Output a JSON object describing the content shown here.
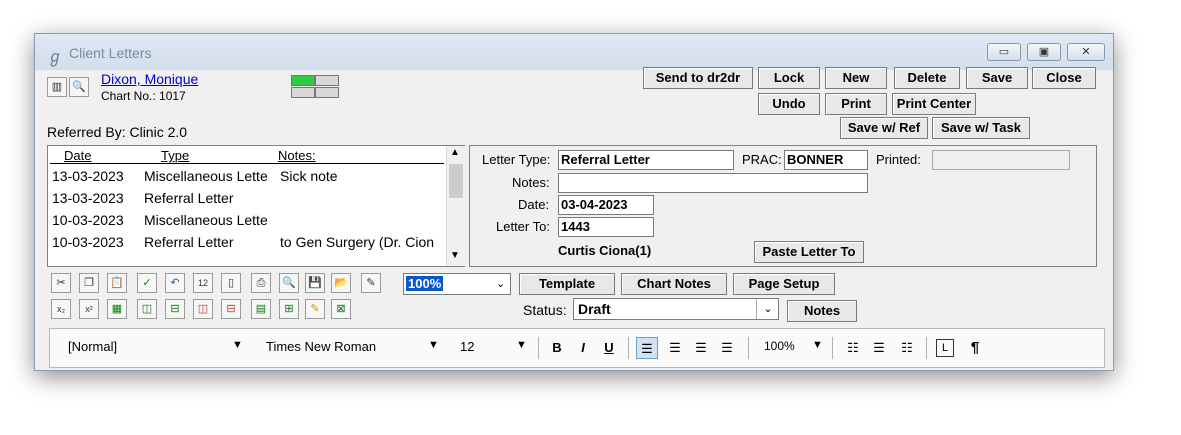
{
  "window": {
    "title": "Client Letters",
    "controls": [
      "minimize-icon",
      "restore-icon",
      "close-icon"
    ]
  },
  "patient": {
    "name": "Dixon, Monique",
    "chart_no": "Chart No.: 1017",
    "referred_by": "Referred By: Clinic 2.0"
  },
  "actions": {
    "send": "Send to dr2dr",
    "lock": "Lock",
    "new": "New",
    "delete": "Delete",
    "save": "Save",
    "close": "Close",
    "undo": "Undo",
    "print": "Print",
    "print_center": "Print Center",
    "save_ref": "Save w/ Ref",
    "save_task": "Save w/ Task"
  },
  "letters_list": {
    "headers": [
      "Date",
      "Type",
      "Notes:"
    ],
    "rows": [
      {
        "date": "13-03-2023",
        "type": "Miscellaneous Lette",
        "notes": "Sick note"
      },
      {
        "date": "13-03-2023",
        "type": "Referral Letter",
        "notes": ""
      },
      {
        "date": "10-03-2023",
        "type": "Miscellaneous Lette",
        "notes": ""
      },
      {
        "date": "10-03-2023",
        "type": "Referral Letter",
        "notes": "to Gen Surgery (Dr. Cion"
      }
    ]
  },
  "details": {
    "letter_type_label": "Letter Type:",
    "letter_type": "Referral Letter",
    "prac_label": "PRAC:",
    "prac": "BONNER",
    "printed_label": "Printed:",
    "printed": "",
    "notes_label": "Notes:",
    "notes": "",
    "date_label": "Date:",
    "date": "03-04-2023",
    "letter_to_label": "Letter To:",
    "letter_to": "1443",
    "recipient": "Curtis Ciona(1)",
    "paste_letter_to": "Paste Letter To"
  },
  "toolbar": {
    "zoom": "100%",
    "template": "Template",
    "chart_notes": "Chart Notes",
    "page_setup": "Page Setup",
    "status_label": "Status:",
    "status": "Draft",
    "notes_button": "Notes"
  },
  "editor": {
    "style": "[Normal]",
    "font": "Times New Roman",
    "size": "12",
    "zoom": "100%",
    "bold": "B",
    "italic": "I",
    "underline": "U",
    "pilcrow": "¶"
  },
  "colors": {
    "link": "#0000cc",
    "accent_green": "#2ecc40",
    "highlight": "#0a58ca"
  }
}
